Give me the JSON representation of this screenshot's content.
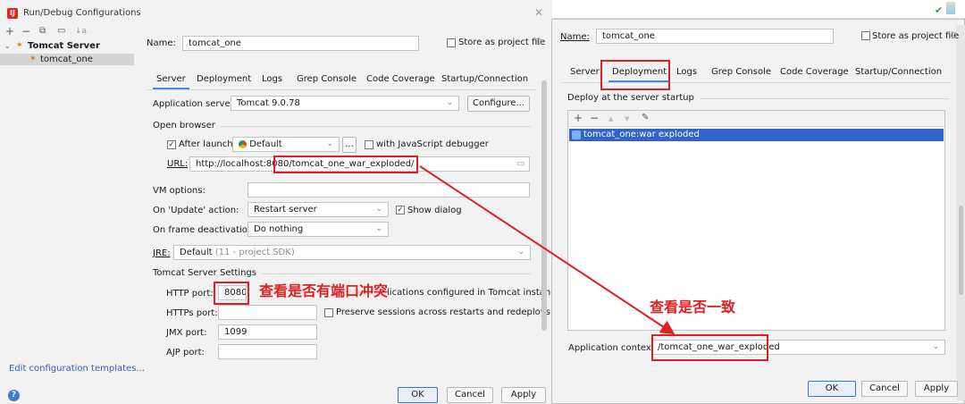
{
  "left_window": {
    "title": "Run/Debug Configurations",
    "close_glyph": "✕",
    "toolbar": {
      "add": "+",
      "remove": "−",
      "copy": "⧉",
      "move": "▭",
      "sort": "↓a"
    },
    "tree": {
      "group_label": "Tomcat Server",
      "item_label": "tomcat_one"
    },
    "edit_templates": "Edit configuration templates...",
    "help": "?",
    "name_label": "Name:",
    "name_value": "tomcat_one",
    "store_label": "Store as project file",
    "tabs": [
      "Server",
      "Deployment",
      "Logs",
      "Grep Console",
      "Code Coverage",
      "Startup/Connection"
    ],
    "app_server_label": "Application server:",
    "app_server_value": "Tomcat 9.0.78",
    "configure_label": "Configure...",
    "open_browser_label": "Open browser",
    "after_launch_label": "After launch",
    "browser_value": "Default",
    "ellipsis": "...",
    "js_debugger_label": "with JavaScript debugger",
    "url_label": "URL:",
    "url_prefix": "http://localhost:8080",
    "url_path": "/tomcat_one_war_exploded/",
    "vm_options_label": "VM options:",
    "on_update_label": "On 'Update' action:",
    "on_update_value": "Restart server",
    "show_dialog_label": "Show dialog",
    "on_frame_label": "On frame deactivation:",
    "on_frame_value": "Do nothing",
    "jre_label": "JRE:",
    "jre_value": "Default",
    "jre_hint": "(11 - project SDK)",
    "tomcat_settings_label": "Tomcat Server Settings",
    "http_port_label": "HTTP port:",
    "http_port_value": "8080",
    "https_port_label": "HTTPs port:",
    "jmx_port_label": "JMX port:",
    "jmx_port_value": "1099",
    "ajp_port_label": "AJP port:",
    "deploy_apps_label": "Deploy applications configured in Tomcat instance",
    "preserve_sessions_label": "Preserve sessions across restarts and redeploys",
    "ok": "OK",
    "cancel": "Cancel",
    "apply": "Apply"
  },
  "right_window": {
    "name_label": "Name:",
    "name_value": "tomcat_one",
    "store_label": "Store as project file",
    "tabs": [
      "Server",
      "Deployment",
      "Logs",
      "Grep Console",
      "Code Coverage",
      "Startup/Connection"
    ],
    "deploy_label": "Deploy at the server startup",
    "toolbar": {
      "add": "+",
      "remove": "−",
      "up": "▲",
      "down": "▼",
      "edit": "✎"
    },
    "artifact": "tomcat_one:war exploded",
    "app_context_label": "Application context:",
    "app_context_value": "/tomcat_one_war_exploded",
    "ok": "OK",
    "cancel": "Cancel",
    "apply": "Apply"
  },
  "annotations": {
    "port_note": "查看是否有端口冲突",
    "context_note": "查看是否一致"
  },
  "colors": {
    "accent": "#4a88e8",
    "selection": "#2f65ca",
    "annotation": "#e02020"
  }
}
